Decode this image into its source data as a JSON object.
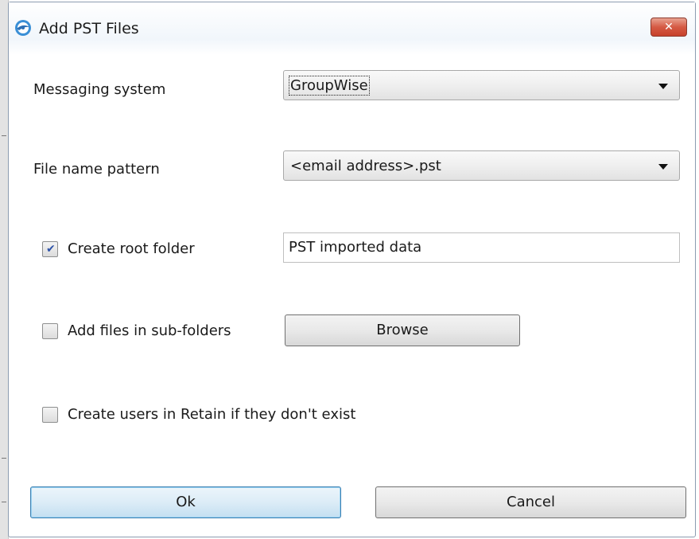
{
  "window": {
    "title": "Add PST Files",
    "close_glyph": "✕",
    "icon": "app-logo-icon"
  },
  "form": {
    "messaging_system": {
      "label": "Messaging system",
      "selected": "GroupWise"
    },
    "file_name_pattern": {
      "label": "File name pattern",
      "selected": "<email address>.pst"
    },
    "create_root_folder": {
      "label": "Create root folder",
      "checked": true,
      "value": "PST imported data"
    },
    "add_subfolders": {
      "label": "Add files in sub-folders",
      "checked": false,
      "browse_label": "Browse"
    },
    "create_users": {
      "label": "Create users in Retain if they don't exist",
      "checked": false
    }
  },
  "actions": {
    "ok_label": "Ok",
    "cancel_label": "Cancel"
  },
  "colors": {
    "close_button": "#d55a44",
    "check_mark": "#2e53a8",
    "default_button_border": "#3c7fb1"
  }
}
